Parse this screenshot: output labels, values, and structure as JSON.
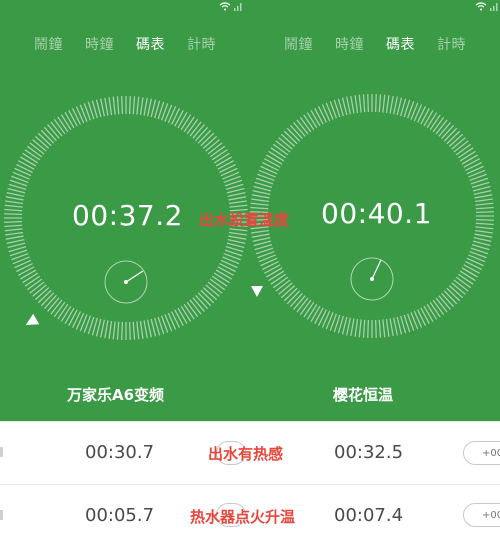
{
  "tabs": [
    "鬧鐘",
    "時鐘",
    "碼表",
    "計時"
  ],
  "active_tab_index": 2,
  "left": {
    "time": "00:37.2",
    "place": "万家乐A6变频",
    "laps": [
      "00:30.7",
      "00:05.7"
    ]
  },
  "right": {
    "time": "00:40.1",
    "place": "樱花恒温",
    "laps": [
      "00:32.5",
      "00:07.4"
    ],
    "lap_pill_label": "+00"
  },
  "overlays": {
    "water_temp_setting": "出水設置溫度",
    "water_heat_feel": "出水有热感",
    "ignition_heating": "热水器点火升温"
  },
  "colors": {
    "green": "#3a9a46",
    "overlay_red": "#e8473d"
  },
  "icons": [
    "wifi-icon",
    "signal-icon",
    "play-triangle-icon"
  ]
}
